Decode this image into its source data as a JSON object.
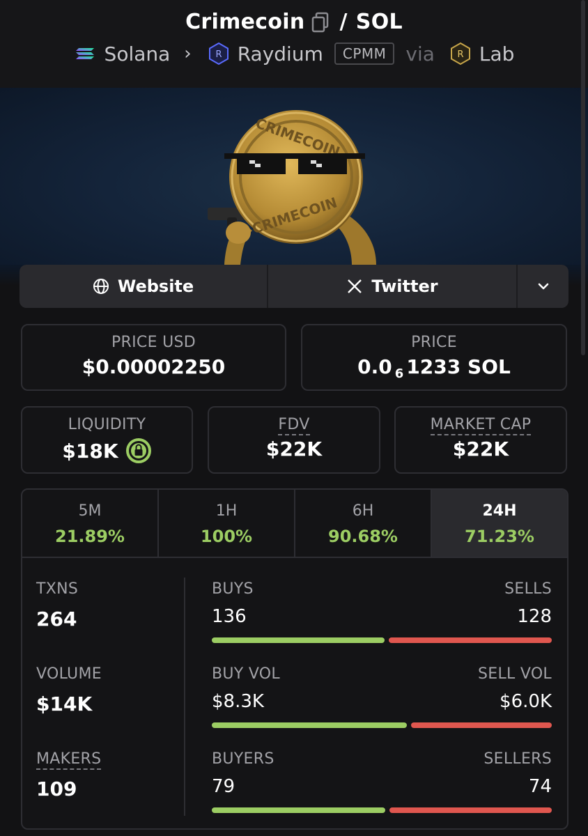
{
  "header": {
    "token_name": "Crimecoin",
    "quote": "SOL",
    "chain": "Solana",
    "dex": "Raydium",
    "pool_type": "CPMM",
    "via": "via",
    "launchpad": "Lab"
  },
  "links": {
    "website": "Website",
    "twitter": "Twitter"
  },
  "prices": {
    "price_usd_label": "PRICE USD",
    "price_usd": "$0.00002250",
    "price_label": "PRICE",
    "price_prefix": "0.0",
    "price_zeros": "6",
    "price_suffix": "1233 SOL"
  },
  "metrics": {
    "liquidity_label": "LIQUIDITY",
    "liquidity": "$18K",
    "fdv_label": "FDV",
    "fdv": "$22K",
    "mcap_label": "MARKET CAP",
    "mcap": "$22K"
  },
  "timeframes": [
    {
      "label": "5M",
      "change": "21.89%"
    },
    {
      "label": "1H",
      "change": "100%"
    },
    {
      "label": "6H",
      "change": "90.68%"
    },
    {
      "label": "24H",
      "change": "71.23%"
    }
  ],
  "active_timeframe": "24H",
  "stats": {
    "txns_label": "TXNS",
    "txns": "264",
    "volume_label": "VOLUME",
    "volume": "$14K",
    "makers_label": "MAKERS",
    "makers": "109"
  },
  "breakdown": {
    "buys_label": "BUYS",
    "buys": "136",
    "sells_label": "SELLS",
    "sells": "128",
    "buy_vol_label": "BUY VOL",
    "buy_vol": "$8.3K",
    "sell_vol_label": "SELL VOL",
    "sell_vol": "$6.0K",
    "buyers_label": "BUYERS",
    "buyers": "79",
    "sellers_label": "SELLERS",
    "sellers": "74"
  },
  "bar_fractions": {
    "buys": 0.515,
    "buy_vol": 0.58,
    "buyers": 0.516
  },
  "colors": {
    "positive": "#9ccd63",
    "negative": "#e0574f",
    "background": "#121214"
  }
}
